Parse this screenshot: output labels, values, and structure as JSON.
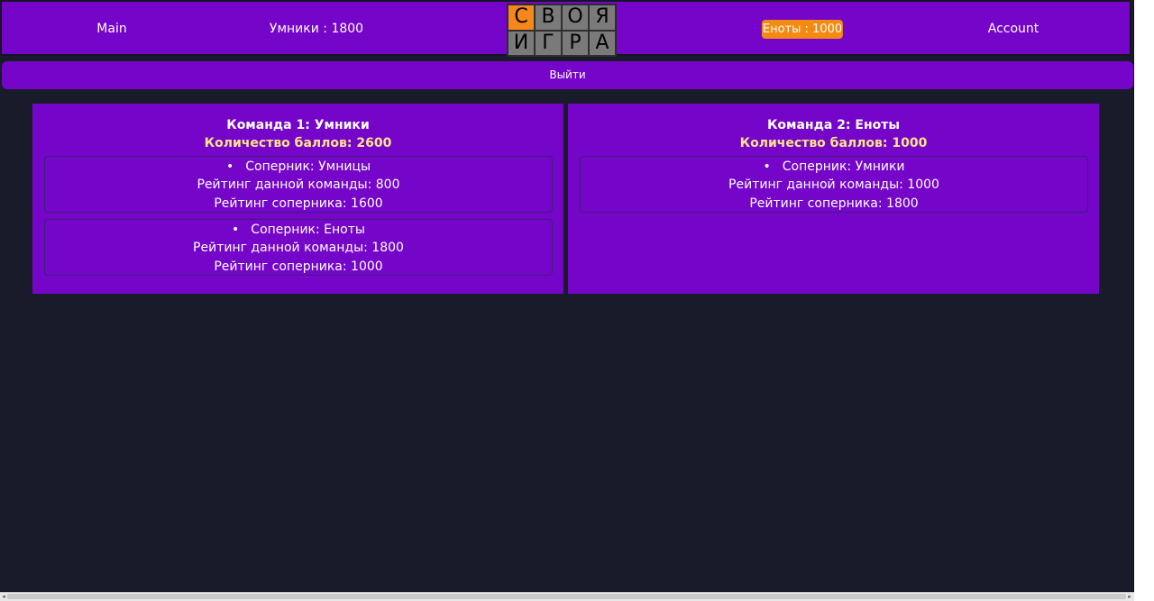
{
  "nav": {
    "main": "Main",
    "team1": "Умники : 1800",
    "team2": "Еноты : 1000",
    "account": "Account"
  },
  "logo": {
    "row1": [
      "С",
      "В",
      "О",
      "Я"
    ],
    "row2": [
      "И",
      "Г",
      "Р",
      "А"
    ],
    "orange_cells": [
      0
    ]
  },
  "logout": "Выйти",
  "teams": [
    {
      "title": "Команда 1: Умники",
      "score": "Количество баллов: 2600",
      "matches": [
        {
          "bullet": "•",
          "opponent": "Соперник: Умницы",
          "own_rating": "Рейтинг данной команды: 800",
          "opp_rating": "Рейтинг соперника: 1600"
        },
        {
          "bullet": "•",
          "opponent": "Соперник: Еноты",
          "own_rating": "Рейтинг данной команды: 1800",
          "opp_rating": "Рейтинг соперника: 1000"
        }
      ]
    },
    {
      "title": "Команда 2: Еноты",
      "score": "Количество баллов: 1000",
      "matches": [
        {
          "bullet": "•",
          "opponent": "Соперник: Умники",
          "own_rating": "Рейтинг данной команды: 1000",
          "opp_rating": "Рейтинг соперника: 1800"
        }
      ]
    }
  ],
  "scrollbar": {
    "left_arrow": "◂",
    "right_arrow": "▸"
  },
  "colors": {
    "background": "#191a2a",
    "panel": "#7405c9",
    "accent": "#f58a12",
    "score_text": "#ffe48a"
  }
}
